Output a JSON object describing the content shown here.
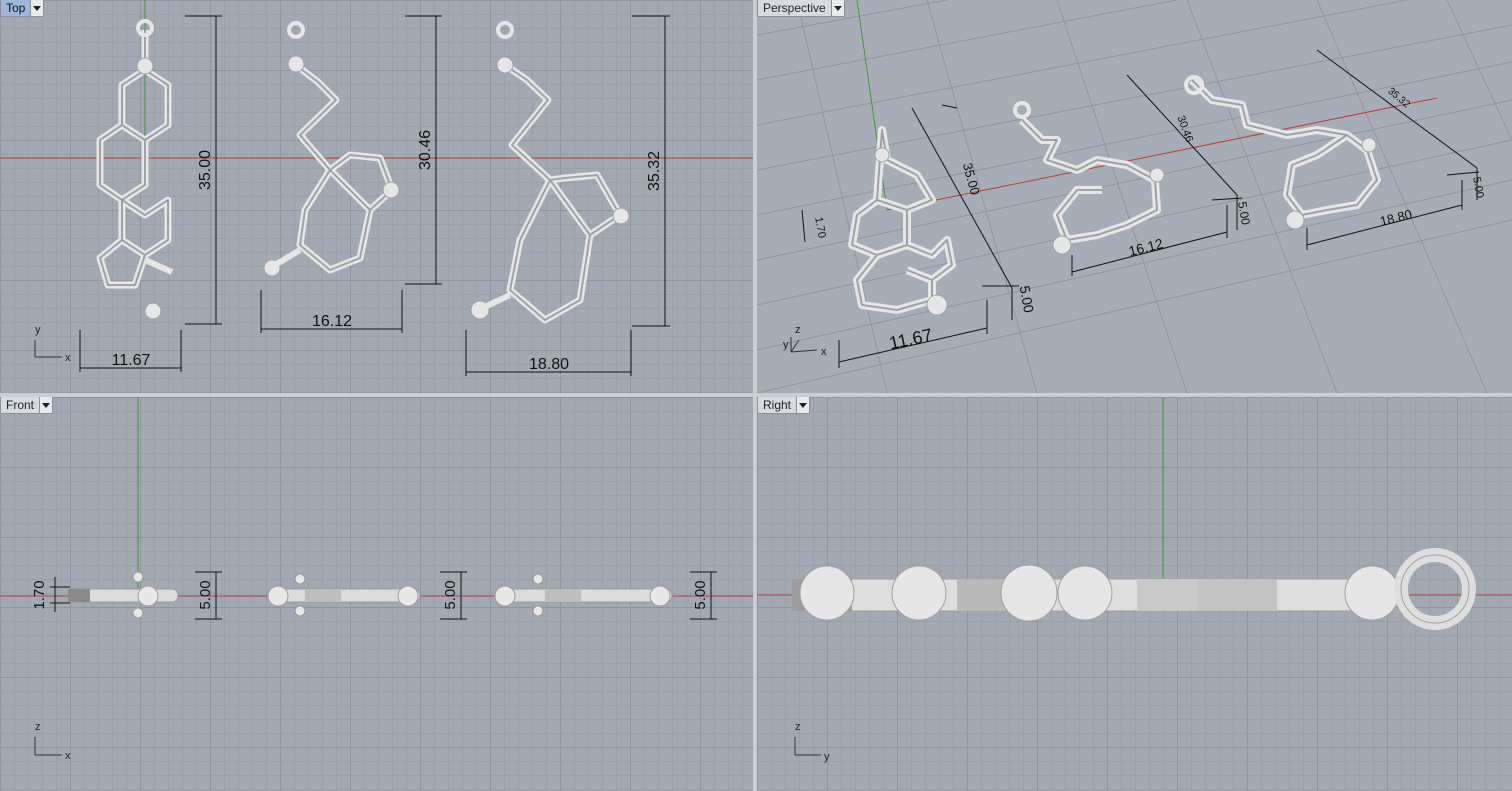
{
  "viewports": {
    "top": {
      "label": "Top"
    },
    "perspective": {
      "label": "Perspective"
    },
    "front": {
      "label": "Front"
    },
    "right": {
      "label": "Right"
    }
  },
  "top_dims": {
    "m1_width": "11.67",
    "m1_height": "35.00",
    "m2_width": "16.12",
    "m2_height": "30.46",
    "m3_width": "18.80",
    "m3_height": "35.32"
  },
  "persp_dims": {
    "m1_width": "11.67",
    "m1_height": "35.00",
    "m1_thick": "5.00",
    "m1_small": "1.70",
    "m2_width": "16.12",
    "m2_height": "30.46",
    "m2_thick": "5.00",
    "m3_width": "18.80",
    "m3_height": "35.32",
    "m3_thick": "5.00"
  },
  "front_dims": {
    "d1": "1.70",
    "d2": "5.00",
    "d3": "5.00",
    "d4": "5.00"
  },
  "axes": {
    "top": {
      "a": "y",
      "b": "x"
    },
    "persp": {
      "a": "z",
      "b": "y",
      "c": "x"
    },
    "front": {
      "a": "z",
      "b": "x"
    },
    "right": {
      "a": "z",
      "b": "y"
    }
  },
  "colors": {
    "x_axis": "#c0393b",
    "y_axis": "#3a9b3a",
    "model": "#dcdcdc",
    "grid": "#8e959e"
  }
}
